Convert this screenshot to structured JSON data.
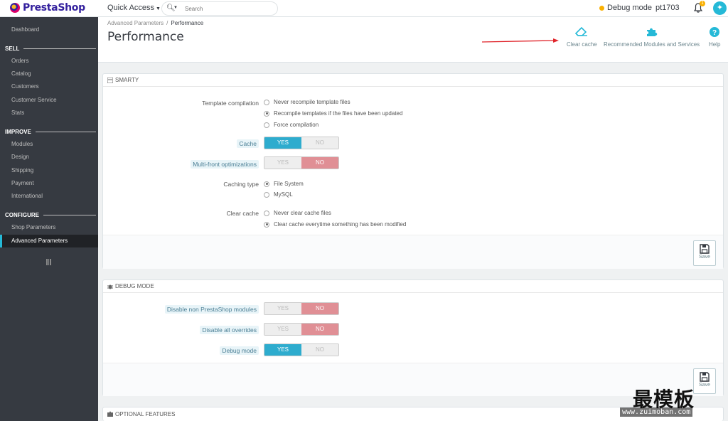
{
  "app": {
    "logo_text": "PrestaShop"
  },
  "topbar": {
    "quick_access": "Quick Access",
    "search_placeholder": "Search",
    "debug_mode": "Debug mode",
    "employee": "pt1703",
    "notifications_count": "1"
  },
  "sidebar": {
    "dashboard": "Dashboard",
    "sections": [
      {
        "title": "SELL",
        "items": [
          "Orders",
          "Catalog",
          "Customers",
          "Customer Service",
          "Stats"
        ]
      },
      {
        "title": "IMPROVE",
        "items": [
          "Modules",
          "Design",
          "Shipping",
          "Payment",
          "International"
        ]
      },
      {
        "title": "CONFIGURE",
        "items": [
          "Shop Parameters",
          "Advanced Parameters"
        ]
      }
    ],
    "active_item": "Advanced Parameters"
  },
  "header": {
    "breadcrumb": [
      "Advanced Parameters",
      "Performance"
    ],
    "title": "Performance",
    "toolbar": {
      "clear_cache": "Clear cache",
      "recommended": "Recommended Modules and Services",
      "help": "Help"
    }
  },
  "smarty": {
    "title": "SMARTY",
    "template_compilation": {
      "label": "Template compilation",
      "options": [
        "Never recompile template files",
        "Recompile templates if the files have been updated",
        "Force compilation"
      ],
      "selected": 1
    },
    "cache": {
      "label": "Cache",
      "yes": "YES",
      "no": "NO",
      "value": "YES"
    },
    "multi_front": {
      "label": "Multi-front optimizations",
      "yes": "YES",
      "no": "NO",
      "value": "NO"
    },
    "caching_type": {
      "label": "Caching type",
      "options": [
        "File System",
        "MySQL"
      ],
      "selected": 0
    },
    "clear_cache": {
      "label": "Clear cache",
      "options": [
        "Never clear cache files",
        "Clear cache everytime something has been modified"
      ],
      "selected": 1
    },
    "save": "Save"
  },
  "debug": {
    "title": "DEBUG MODE",
    "disable_non_ps": {
      "label": "Disable non PrestaShop modules",
      "yes": "YES",
      "no": "NO",
      "value": "NO"
    },
    "disable_overrides": {
      "label": "Disable all overrides",
      "yes": "YES",
      "no": "NO",
      "value": "NO"
    },
    "debug_mode": {
      "label": "Debug mode",
      "yes": "YES",
      "no": "NO",
      "value": "YES"
    },
    "save": "Save"
  },
  "optional": {
    "title": "OPTIONAL FEATURES"
  },
  "watermark": {
    "title": "最模板",
    "url": "www.zuimoban.com"
  },
  "colors": {
    "accent": "#25b9d7",
    "switch_yes": "#2eacce",
    "switch_no": "#e08f95",
    "sidebar": "#363a41",
    "debug_dot": "#fab000"
  }
}
